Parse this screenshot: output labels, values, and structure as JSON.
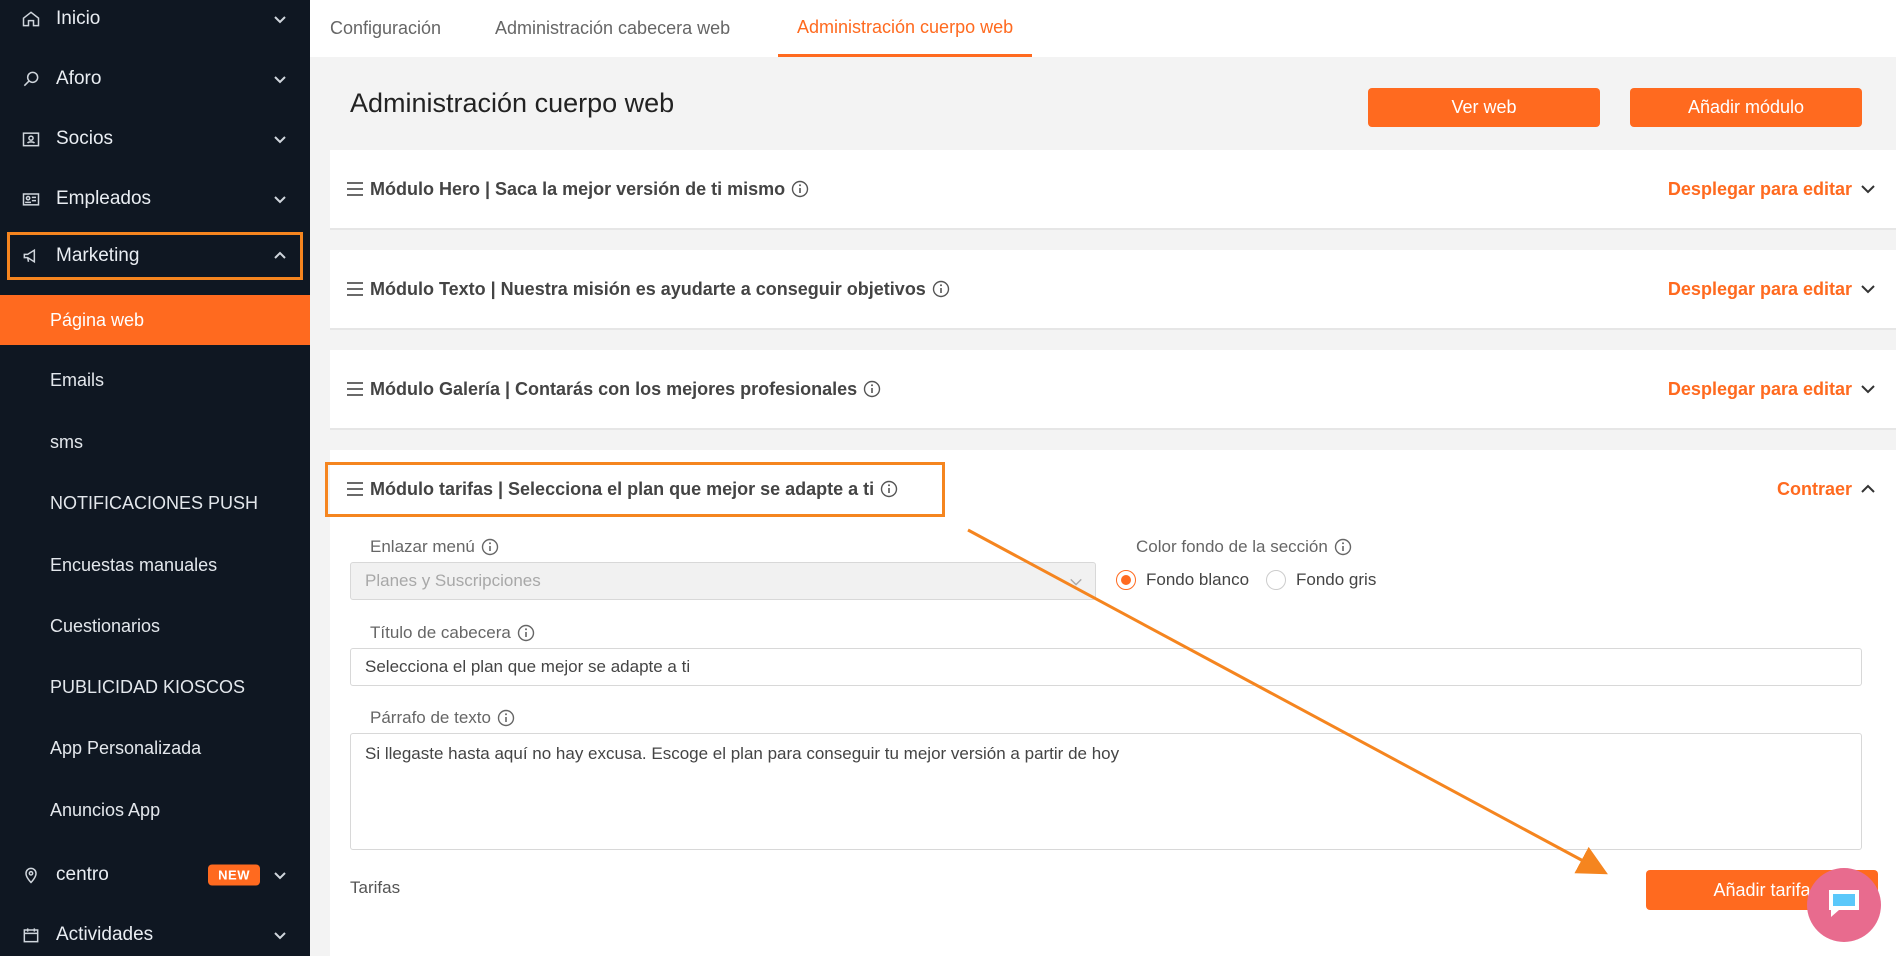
{
  "sidebar": {
    "items": [
      {
        "label": "Inicio",
        "icon": "home-icon"
      },
      {
        "label": "Aforo",
        "icon": "search-icon"
      },
      {
        "label": "Socios",
        "icon": "contact-card-icon"
      },
      {
        "label": "Empleados",
        "icon": "id-card-icon"
      },
      {
        "label": "Marketing",
        "icon": "megaphone-icon"
      }
    ],
    "subitems": [
      {
        "label": "Página web",
        "active": true
      },
      {
        "label": "Emails"
      },
      {
        "label": "sms"
      },
      {
        "label": "NOTIFICACIONES PUSH"
      },
      {
        "label": "Encuestas manuales"
      },
      {
        "label": "Cuestionarios"
      },
      {
        "label": "PUBLICIDAD KIOSCOS"
      },
      {
        "label": "App Personalizada"
      },
      {
        "label": "Anuncios App"
      }
    ],
    "centro": {
      "label": "centro",
      "badge": "NEW",
      "icon": "location-pin-icon"
    },
    "actividades": {
      "label": "Actividades",
      "icon": "calendar-icon"
    }
  },
  "tabs": [
    {
      "label": "Configuración"
    },
    {
      "label": "Administración cabecera web"
    },
    {
      "label": "Administración cuerpo web",
      "active": true
    }
  ],
  "page": {
    "title": "Administración cuerpo web",
    "view_web_label": "Ver web",
    "add_module_label": "Añadir módulo"
  },
  "modules": [
    {
      "title": "Módulo Hero | Saca la mejor versión de ti mismo",
      "action": "Desplegar para editar"
    },
    {
      "title": "Módulo Texto | Nuestra misión es ayudarte a conseguir objetivos",
      "action": "Desplegar para editar"
    },
    {
      "title": "Módulo Galería | Contarás con los mejores profesionales",
      "action": "Desplegar para editar"
    },
    {
      "title": "Módulo tarifas | Selecciona el plan que mejor se adapte a ti",
      "action": "Contraer"
    }
  ],
  "tarifas_form": {
    "link_menu_label": "Enlazar menú",
    "link_menu_value": "Planes y Suscripciones",
    "bg_color_label": "Color fondo de la sección",
    "bg_white_label": "Fondo blanco",
    "bg_gray_label": "Fondo gris",
    "header_title_label": "Título de cabecera",
    "header_title_value": "Selecciona el plan que mejor se adapte a ti",
    "paragraph_label": "Párrafo de texto",
    "paragraph_value": "Si llegaste hasta aquí no hay excusa. Escoge el plan para conseguir tu mejor versión a partir de hoy",
    "rates_label": "Tarifas",
    "add_rate_label": "Añadir tarifa"
  },
  "colors": {
    "accent": "#ff6a1f",
    "sidebar_bg": "#0f1722",
    "highlight": "#f5851f"
  }
}
